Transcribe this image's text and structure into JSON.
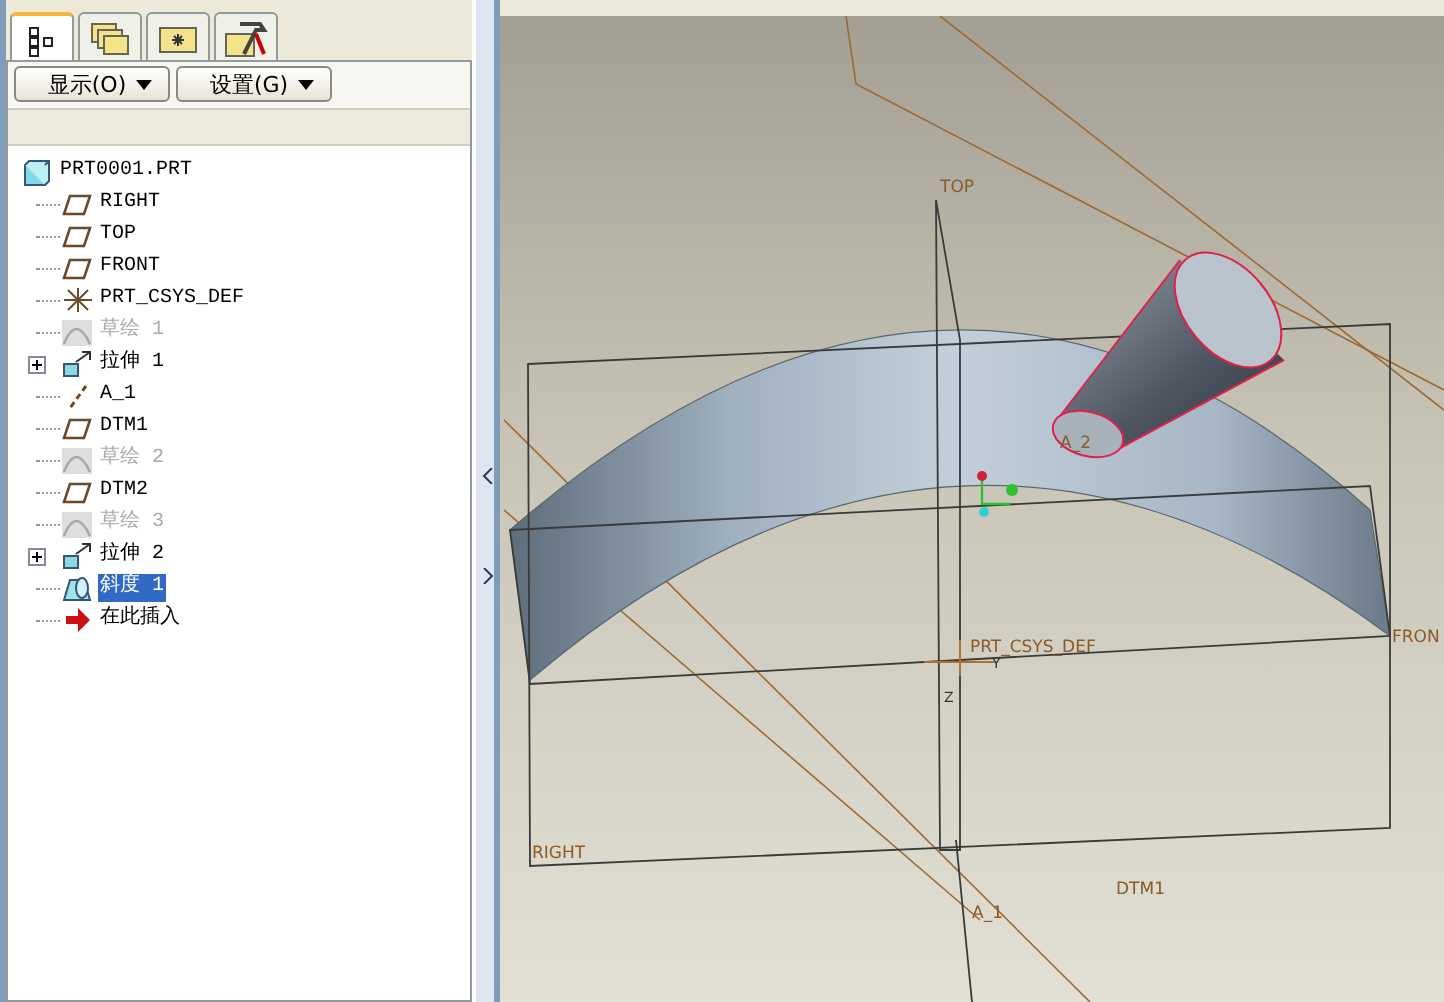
{
  "panel_tabs": [
    {
      "kind": "tree",
      "selected": true
    },
    {
      "kind": "folders",
      "selected": false
    },
    {
      "kind": "favorites",
      "selected": false
    },
    {
      "kind": "tools",
      "selected": false
    }
  ],
  "menu_buttons": [
    {
      "label": "显示(O)"
    },
    {
      "label": "设置(G)"
    }
  ],
  "model_tree": [
    {
      "label": "PRT0001.PRT",
      "kind": "part",
      "selected": false,
      "dimmed": false,
      "children": [
        {
          "label": "RIGHT",
          "kind": "plane",
          "selected": false,
          "dimmed": false,
          "expandable": false
        },
        {
          "label": "TOP",
          "kind": "plane",
          "selected": false,
          "dimmed": false,
          "expandable": false
        },
        {
          "label": "FRONT",
          "kind": "plane",
          "selected": false,
          "dimmed": false,
          "expandable": false
        },
        {
          "label": "PRT_CSYS_DEF",
          "kind": "csys",
          "selected": false,
          "dimmed": false,
          "expandable": false
        },
        {
          "label": "草绘 1",
          "kind": "sketch",
          "selected": false,
          "dimmed": true,
          "expandable": false
        },
        {
          "label": "拉伸 1",
          "kind": "extrude",
          "selected": false,
          "dimmed": false,
          "expandable": true
        },
        {
          "label": "A_1",
          "kind": "axis",
          "selected": false,
          "dimmed": false,
          "expandable": false
        },
        {
          "label": "DTM1",
          "kind": "plane",
          "selected": false,
          "dimmed": false,
          "expandable": false
        },
        {
          "label": "草绘 2",
          "kind": "sketch",
          "selected": false,
          "dimmed": true,
          "expandable": false
        },
        {
          "label": "DTM2",
          "kind": "plane",
          "selected": false,
          "dimmed": false,
          "expandable": false
        },
        {
          "label": "草绘 3",
          "kind": "sketch",
          "selected": false,
          "dimmed": true,
          "expandable": false
        },
        {
          "label": "拉伸 2",
          "kind": "extrude",
          "selected": false,
          "dimmed": false,
          "expandable": true
        },
        {
          "label": "斜度 1",
          "kind": "draft",
          "selected": true,
          "dimmed": false,
          "expandable": false
        },
        {
          "label": "在此插入",
          "kind": "insert",
          "selected": false,
          "dimmed": false,
          "expandable": false
        }
      ]
    }
  ],
  "viewport": {
    "labels": {
      "top_plane": "TOP",
      "axis_2": "A_2",
      "csys": "PRT_CSYS_DEF",
      "csys_y": "Y",
      "csys_z": "Z",
      "front_plane": "FRON",
      "right_plane": "RIGHT",
      "axis_1": "A_1",
      "datum_plane": "DTM1"
    }
  }
}
